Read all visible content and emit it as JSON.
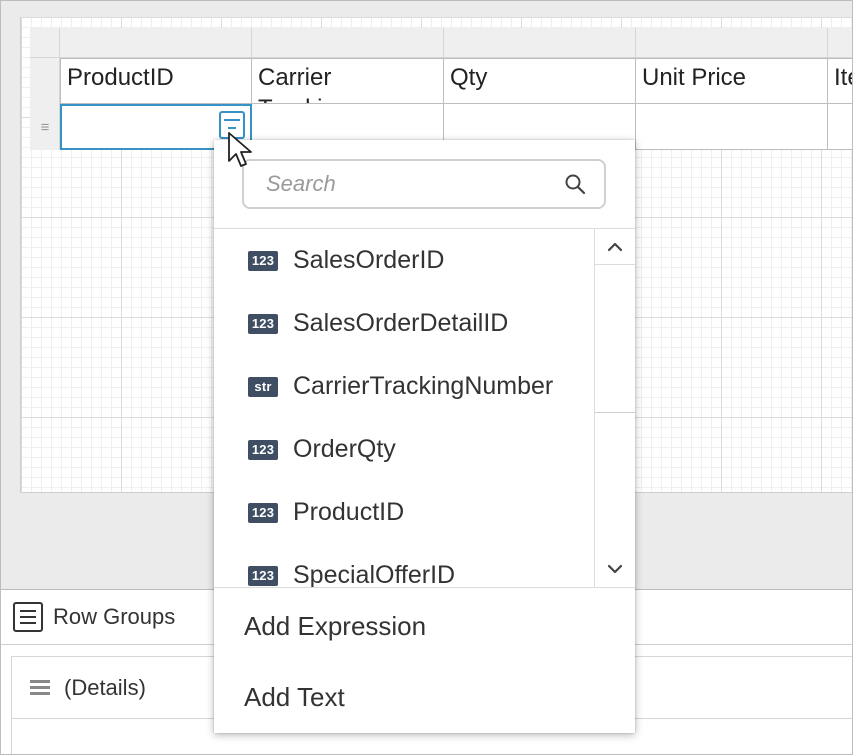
{
  "table": {
    "headers": [
      "ProductID",
      "Carrier Tracking Number",
      "Qty",
      "Unit Price",
      "Ite"
    ],
    "detail_cells": [
      "",
      "",
      "",
      "",
      ""
    ]
  },
  "field_picker": {
    "search": {
      "placeholder": "Search",
      "value": ""
    },
    "fields": [
      {
        "type": "123",
        "name": "SalesOrderID"
      },
      {
        "type": "123",
        "name": "SalesOrderDetailID"
      },
      {
        "type": "str",
        "name": "CarrierTrackingNumber"
      },
      {
        "type": "123",
        "name": "OrderQty"
      },
      {
        "type": "123",
        "name": "ProductID"
      },
      {
        "type": "123",
        "name": "SpecialOfferID"
      }
    ],
    "actions": {
      "add_expression": "Add Expression",
      "add_text": "Add Text"
    }
  },
  "grouping_pane": {
    "title": "Row Groups",
    "items": [
      "(Details)"
    ]
  },
  "colors": {
    "accent": "#3792c8",
    "type_badge": "#3f4e63"
  },
  "icons": [
    "field-picker-icon",
    "search-icon",
    "chevron-up-icon",
    "chevron-down-icon",
    "row-groups-icon",
    "drag-handle-icon",
    "mouse-cursor-icon"
  ]
}
